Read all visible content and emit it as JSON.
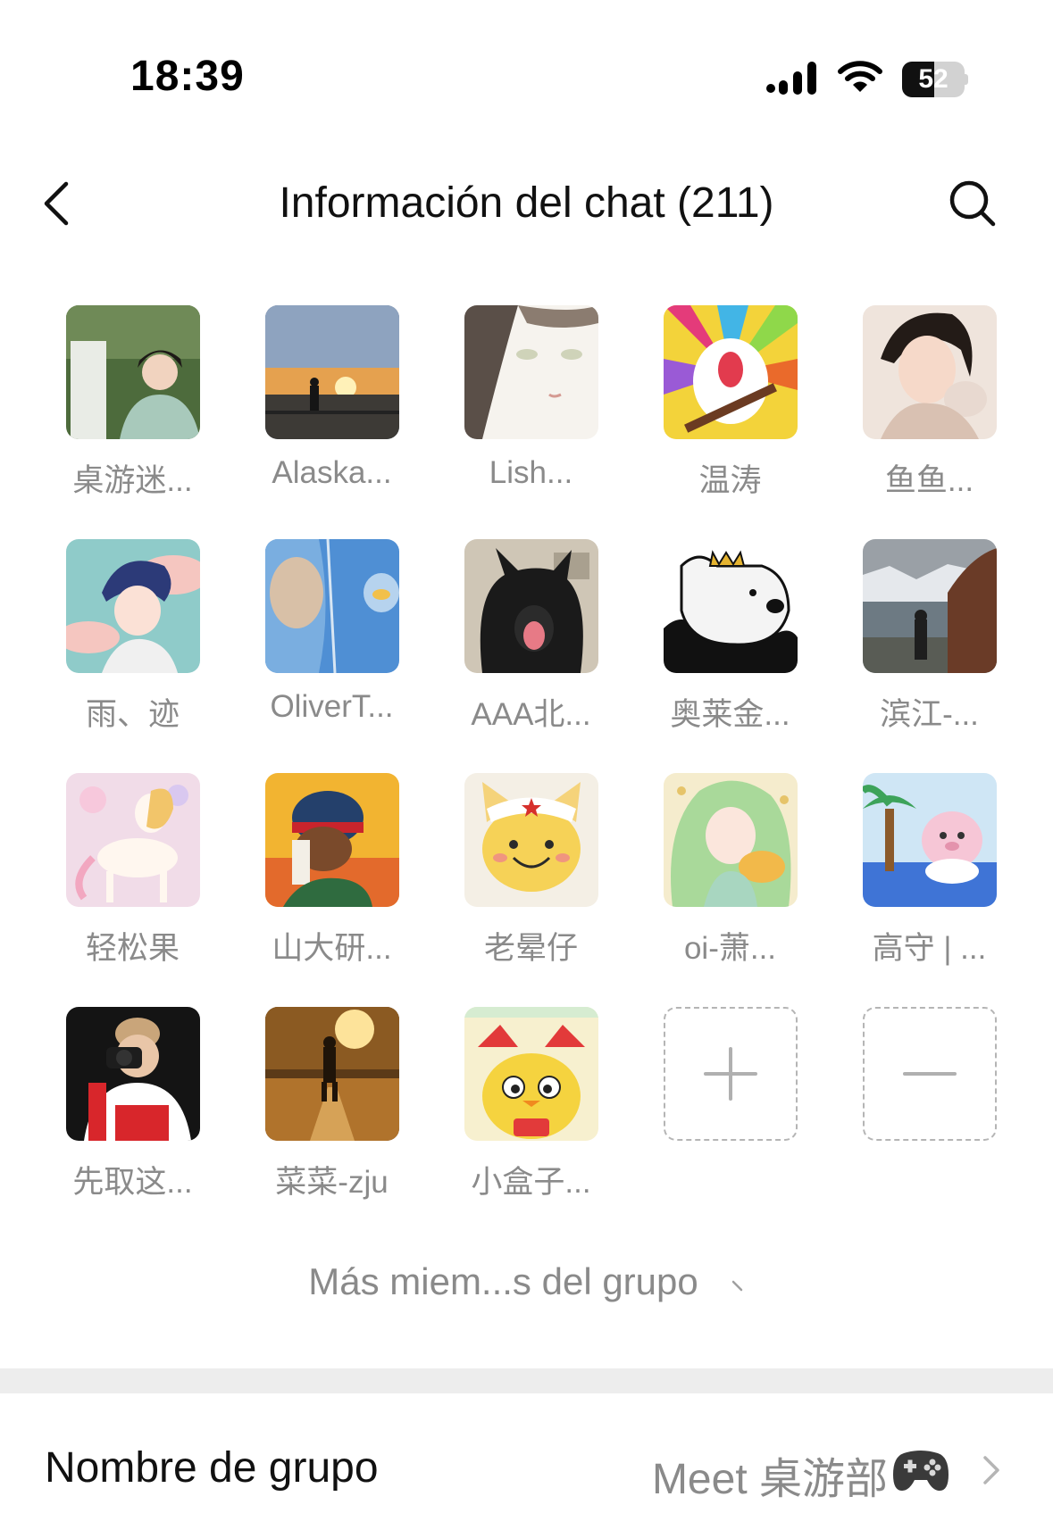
{
  "status_bar": {
    "time": "18:39",
    "battery_level": "52",
    "battery_fraction": 0.52,
    "signal_icon": "cellular-signal-icon",
    "wifi_icon": "wifi-icon"
  },
  "nav": {
    "title": "Información del chat (211)",
    "back_icon": "back-chevron-icon",
    "search_icon": "search-icon"
  },
  "members": [
    {
      "name": "桌游迷..."
    },
    {
      "name": "Alaska..."
    },
    {
      "name": "Lish..."
    },
    {
      "name": "温涛"
    },
    {
      "name": "鱼鱼..."
    },
    {
      "name": "雨、迹"
    },
    {
      "name": "OliverT..."
    },
    {
      "name": "AAA北..."
    },
    {
      "name": "奥莱金..."
    },
    {
      "name": "滨江-..."
    },
    {
      "name": "轻松果"
    },
    {
      "name": "山大研..."
    },
    {
      "name": "老晕仔"
    },
    {
      "name": "oi-萧..."
    },
    {
      "name": "高守 | ..."
    },
    {
      "name": "先取这..."
    },
    {
      "name": "菜菜-zju"
    },
    {
      "name": "小盒子..."
    }
  ],
  "actions": {
    "add_icon": "plus-icon",
    "remove_icon": "minus-icon"
  },
  "more_members": {
    "label": "Más miem...s del grupo"
  },
  "group_name": {
    "label": "Nombre de grupo",
    "value": "Meet 桌游部",
    "value_icon": "gamepad-icon"
  },
  "colors": {
    "text_primary": "#111111",
    "text_secondary": "#8a8a8a",
    "divider": "#ededed",
    "dashed_border": "#b5b5b5"
  }
}
